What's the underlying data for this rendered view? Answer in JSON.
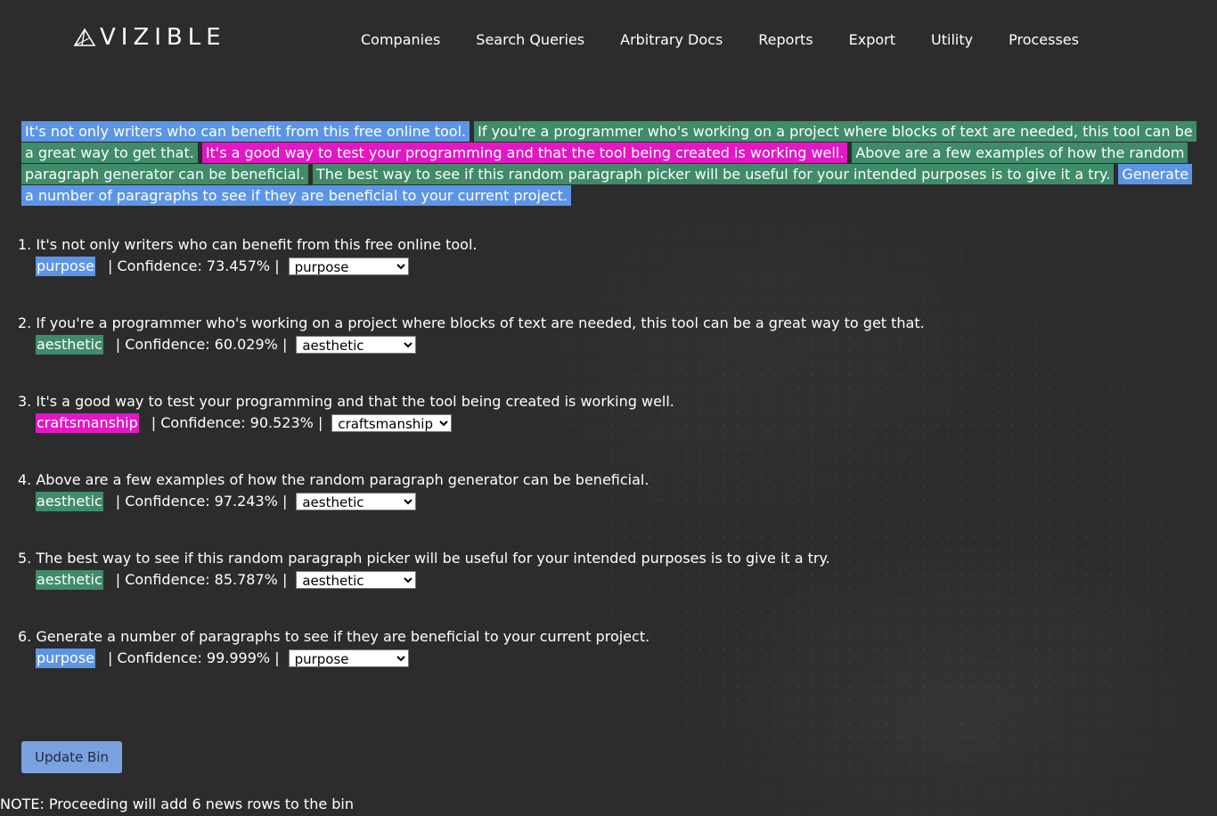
{
  "brand": {
    "logo_text": "VIZIBLE",
    "logo_icon": "pyramid-logo-icon"
  },
  "nav": {
    "items": [
      {
        "label": "Companies"
      },
      {
        "label": "Search Queries"
      },
      {
        "label": "Arbitrary Docs"
      },
      {
        "label": "Reports"
      },
      {
        "label": "Export"
      },
      {
        "label": "Utility"
      },
      {
        "label": "Processes"
      }
    ]
  },
  "colors": {
    "purpose": "#5c95e6",
    "aesthetic": "#3f8b6a",
    "craftsmanship": "#e317c5",
    "background": "#2c2c2c",
    "button": "#7aa2e0"
  },
  "highlighted_paragraph": {
    "segments": [
      {
        "text": "It's not only writers who can benefit from this free online tool.",
        "category": "purpose"
      },
      {
        "text": "If you're a programmer who's working on a project where blocks of text are needed, this tool can be a great way to get that.",
        "category": "aesthetic"
      },
      {
        "text": "It's a good way to test your programming and that the tool being created is working well.",
        "category": "craftsmanship"
      },
      {
        "text": "Above are a few examples of how the random paragraph generator can be beneficial.",
        "category": "aesthetic"
      },
      {
        "text": "The best way to see if this random paragraph picker will be useful for your intended purposes is to give it a try.",
        "category": "aesthetic"
      },
      {
        "text": "Generate a number of paragraphs to see if they are beneficial to your current project.",
        "category": "purpose"
      }
    ]
  },
  "sentences": [
    {
      "number": "1.",
      "text": "It's not only writers who can benefit from this free online tool.",
      "label": "purpose",
      "confidence": "| Confidence: 73.457% |",
      "selected": "purpose"
    },
    {
      "number": "2.",
      "text": "If you're a programmer who's working on a project where blocks of text are needed, this tool can be a great way to get that.",
      "label": "aesthetic",
      "confidence": "| Confidence: 60.029% |",
      "selected": "aesthetic"
    },
    {
      "number": "3.",
      "text": "It's a good way to test your programming and that the tool being created is working well.",
      "label": "craftsmanship",
      "confidence": "| Confidence: 90.523% |",
      "selected": "craftsmanship"
    },
    {
      "number": "4.",
      "text": "Above are a few examples of how the random paragraph generator can be beneficial.",
      "label": "aesthetic",
      "confidence": "| Confidence: 97.243% |",
      "selected": "aesthetic"
    },
    {
      "number": "5.",
      "text": "The best way to see if this random paragraph picker will be useful for your intended purposes is to give it a try.",
      "label": "aesthetic",
      "confidence": "| Confidence: 85.787% |",
      "selected": "aesthetic"
    },
    {
      "number": "6.",
      "text": "Generate a number of paragraphs to see if they are beneficial to your current project.",
      "label": "purpose",
      "confidence": "| Confidence: 99.999% |",
      "selected": "purpose"
    }
  ],
  "actions": {
    "update_bin_label": "Update Bin"
  },
  "note": "NOTE: Proceeding will add 6 news rows to the bin"
}
